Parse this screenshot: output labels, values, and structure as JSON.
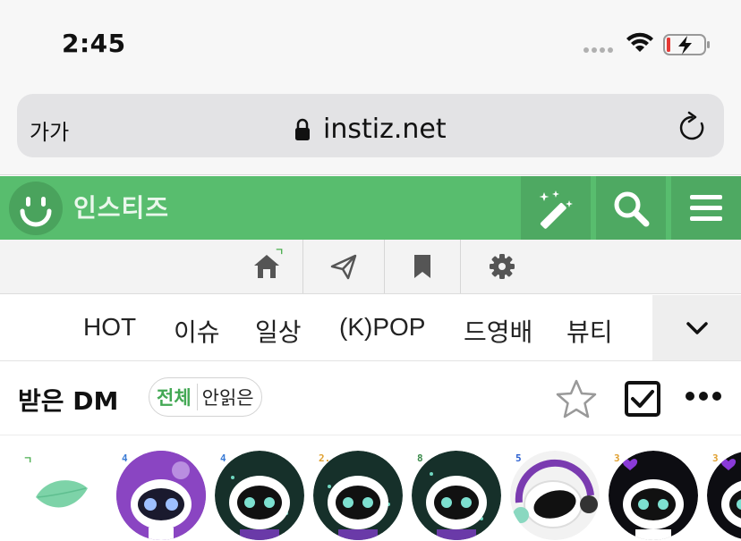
{
  "status_bar": {
    "time": "2:45"
  },
  "address_bar": {
    "text_size_label": "가가",
    "url": "instiz.net"
  },
  "header": {
    "site_name": "인스티즈",
    "brand_color": "#58bd6e"
  },
  "nav": {
    "home_badge": "ㄱ"
  },
  "tabs": [
    {
      "label": "HOT"
    },
    {
      "label": "이슈"
    },
    {
      "label": "일상"
    },
    {
      "label": "(K)POP"
    },
    {
      "label": "드영배"
    },
    {
      "label": "뷰티"
    }
  ],
  "dm": {
    "title": "받은 DM",
    "filter_all": "전체",
    "filter_unread": "안읽은"
  },
  "avatars": [
    {
      "badge": "ㄱ",
      "badge_color": "#4caf50",
      "type": "leaf"
    },
    {
      "badge": "4",
      "badge_color": "#3a7bd5",
      "type": "purple"
    },
    {
      "badge": "4",
      "badge_color": "#3a7bd5",
      "type": "dark"
    },
    {
      "badge": "2.",
      "badge_color": "#e0a030",
      "type": "dark"
    },
    {
      "badge": "8",
      "badge_color": "#3a8a4a",
      "type": "dark"
    },
    {
      "badge": "5",
      "badge_color": "#2a5fd0",
      "type": "headphone"
    },
    {
      "badge": "3",
      "badge_color": "#e0a030",
      "type": "heart"
    },
    {
      "badge": "3",
      "badge_color": "#e0a030",
      "type": "heart"
    }
  ]
}
